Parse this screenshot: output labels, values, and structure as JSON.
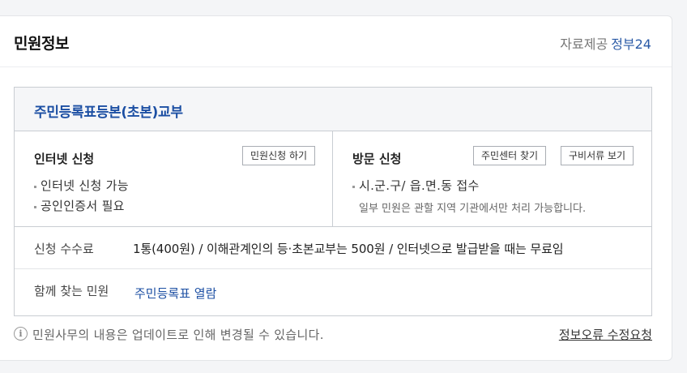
{
  "header": {
    "title": "민원정보",
    "provider_label": "자료제공",
    "provider_link": "정부24"
  },
  "service": {
    "title": "주민등록표등본(초본)교부",
    "internet": {
      "title": "인터넷 신청",
      "button": "민원신청 하기",
      "bullets": [
        "인터넷 신청 가능",
        "공인인증서 필요"
      ]
    },
    "visit": {
      "title": "방문 신청",
      "buttons": [
        "주민센터 찾기",
        "구비서류 보기"
      ],
      "bullets": [
        "시.군.구/ 읍.면.동 접수"
      ],
      "note": "일부 민원은 관할 지역 기관에서만 처리 가능합니다."
    },
    "fee": {
      "label": "신청 수수료",
      "value": "1통(400원) / 이해관계인의 등·초본교부는 500원 / 인터넷으로 발급받을 때는 무료임"
    },
    "related": {
      "label": "함께 찾는 민원",
      "link": "주민등록표 열람"
    }
  },
  "footer": {
    "notice": "민원사무의 내용은 업데이트로 인해 변경될 수 있습니다.",
    "report_link": "정보오류 수정요청",
    "info_icon": "info-icon"
  }
}
